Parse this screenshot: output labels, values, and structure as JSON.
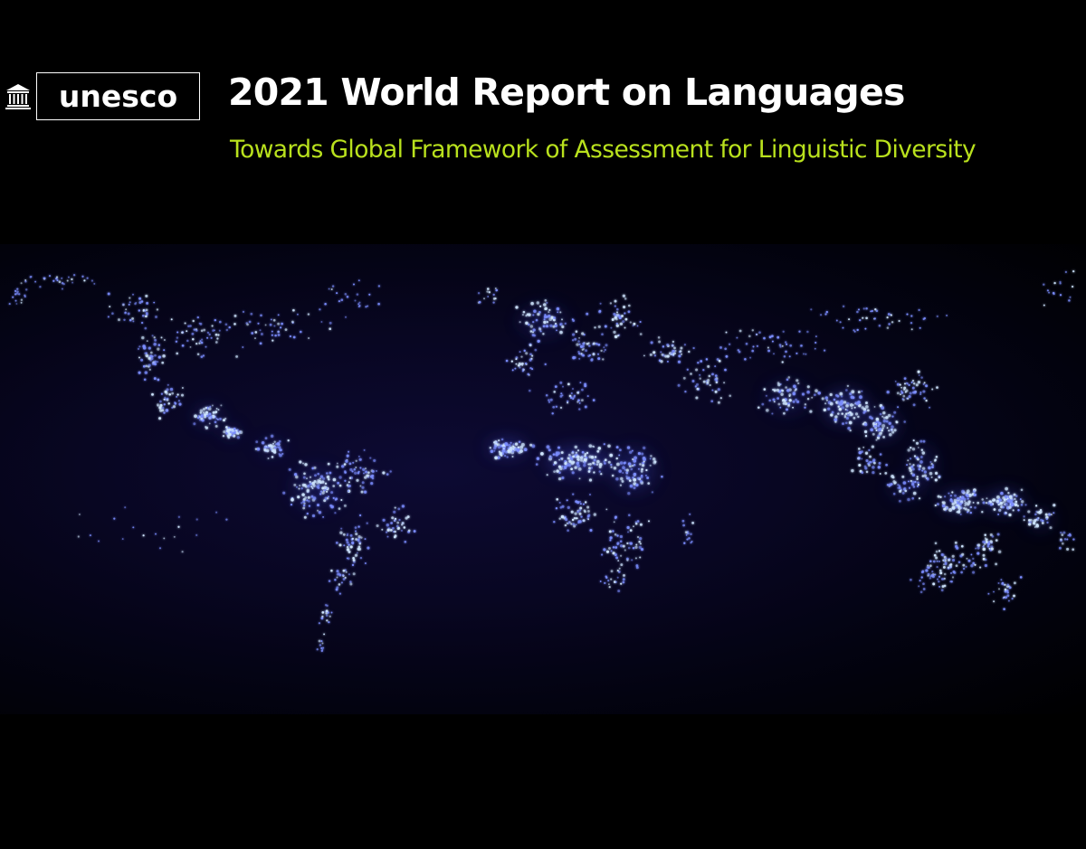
{
  "logo": {
    "wordmark": "unesco",
    "seal_icon": "temple-icon"
  },
  "header": {
    "title": "2021 World Report on Languages",
    "subtitle": "Towards Global Framework of Assessment for Linguistic Diversity"
  },
  "colors": {
    "background": "#000000",
    "title": "#ffffff",
    "subtitle": "#b9e11d",
    "dot_core": "#cfe6ff",
    "dot_glow": "#4a5cff"
  },
  "map": {
    "image": "world map of languages drawn as glowing dots"
  }
}
